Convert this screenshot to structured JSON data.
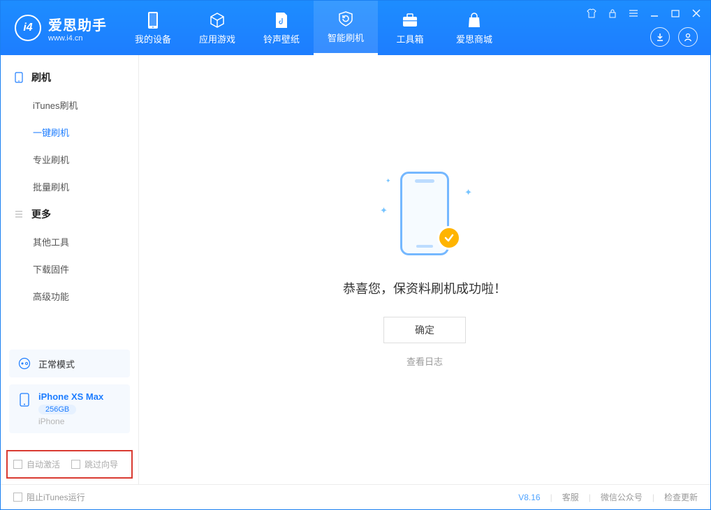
{
  "app": {
    "title": "爱思助手",
    "url": "www.i4.cn"
  },
  "tabs": {
    "device": "我的设备",
    "apps": "应用游戏",
    "ringtones": "铃声壁纸",
    "flash": "智能刷机",
    "toolbox": "工具箱",
    "store": "爱思商城"
  },
  "sidebar": {
    "section_flash": "刷机",
    "items_flash": {
      "itunes": "iTunes刷机",
      "oneclick": "一键刷机",
      "pro": "专业刷机",
      "batch": "批量刷机"
    },
    "section_more": "更多",
    "items_more": {
      "other": "其他工具",
      "firmware": "下载固件",
      "advanced": "高级功能"
    }
  },
  "device": {
    "mode": "正常模式",
    "name": "iPhone XS Max",
    "capacity": "256GB",
    "type": "iPhone"
  },
  "options": {
    "auto_activate": "自动激活",
    "skip_wizard": "跳过向导"
  },
  "main": {
    "success_text": "恭喜您，保资料刷机成功啦！",
    "ok_button": "确定",
    "view_log": "查看日志"
  },
  "footer": {
    "block_itunes": "阻止iTunes运行",
    "version": "V8.16",
    "support": "客服",
    "wechat": "微信公众号",
    "update": "检查更新"
  }
}
